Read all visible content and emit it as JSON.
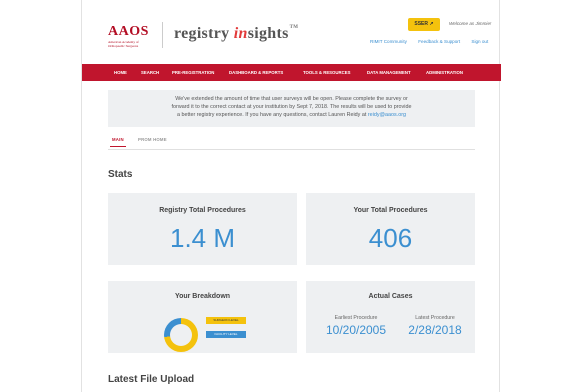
{
  "header": {
    "aaos_abbrev": "AAOS",
    "aaos_full": "American Academy of Orthopaedic Surgeons",
    "product_prefix": "registry",
    "product_i": "in",
    "product_suffix": "sights",
    "trademark": "TM",
    "sso_label": "SSER",
    "welcome_text": "Welcome as Jimmie!",
    "links": [
      "RIMIT Community",
      "Feedback & Support",
      "Sign out"
    ]
  },
  "nav": {
    "items": [
      "HOME",
      "SEARCH",
      "PRE-REGISTRATION",
      "DASHBOARD & REPORTS",
      "TOOLS & RESOURCES",
      "DATA MANAGEMENT",
      "ADMINISTRATION"
    ]
  },
  "notice": {
    "line1": "We've extended the amount of time that user surveys will be open. Please complete the survey or",
    "line2": "forward it to the correct contact at your institution by Sept 7, 2018. The results will be used to provide",
    "line3": "a better registry experience. If you have any questions, contact Lauren Reidy at",
    "email": "reidy@aaos.org"
  },
  "tabs": {
    "active": "MAIN",
    "inactive": "PROM HOME"
  },
  "stats": {
    "title": "Stats",
    "registry_total": {
      "label": "Registry Total Procedures",
      "value": "1.4 M"
    },
    "your_total": {
      "label": "Your Total Procedures",
      "value": "406"
    },
    "breakdown": {
      "label": "Your Breakdown",
      "legend": [
        {
          "label": "SURGEON LEVEL",
          "color": "#f4c20d"
        },
        {
          "label": "FACILITY LEVEL",
          "color": "#3b8fd0"
        }
      ],
      "share_first": 0.73
    },
    "actual_cases": {
      "label": "Actual Cases",
      "earliest_label": "Earliest Procedure",
      "earliest_value": "10/20/2005",
      "latest_label": "Latest Procedure",
      "latest_value": "2/28/2018"
    }
  },
  "latest_upload": {
    "title": "Latest File Upload"
  },
  "colors": {
    "brand_red": "#c0152d",
    "accent_blue": "#3b8fd0",
    "sso_yellow": "#f4c20d",
    "card_bg": "#eef0f2"
  }
}
